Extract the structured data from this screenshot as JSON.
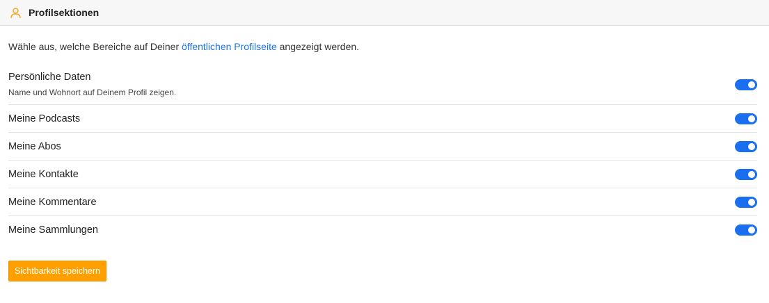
{
  "header": {
    "title": "Profilsektionen",
    "icon": "user-icon",
    "icon_color": "#f5a623"
  },
  "intro": {
    "text_before": "Wähle aus, welche Bereiche auf Deiner ",
    "link_text": "öffentlichen Profilseite",
    "text_after": " angezeigt werden."
  },
  "sections": [
    {
      "label": "Persönliche Daten",
      "description": "Name und Wohnort auf Deinem Profil zeigen.",
      "enabled": true
    },
    {
      "label": "Meine Podcasts",
      "enabled": true
    },
    {
      "label": "Meine Abos",
      "enabled": true
    },
    {
      "label": "Meine Kontakte",
      "enabled": true
    },
    {
      "label": "Meine Kommentare",
      "enabled": true
    },
    {
      "label": "Meine Sammlungen",
      "enabled": true
    }
  ],
  "save_button": {
    "label": "Sichtbarkeit speichern"
  },
  "colors": {
    "accent": "#ff9f00",
    "toggle_on": "#1a6ef0",
    "link": "#1a73e8"
  }
}
